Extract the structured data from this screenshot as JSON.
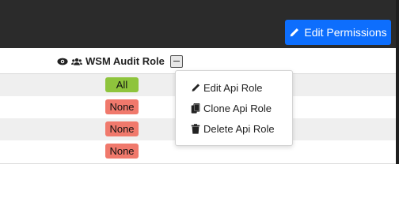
{
  "toolbar": {
    "edit_permissions_label": "Edit Permissions"
  },
  "table": {
    "column_header": "WSM Audit Role",
    "rows": [
      {
        "value": "All",
        "status": "all"
      },
      {
        "value": "None",
        "status": "none"
      },
      {
        "value": "None",
        "status": "none"
      },
      {
        "value": "None",
        "status": "none"
      }
    ]
  },
  "dropdown": {
    "items": [
      {
        "label": "Edit Api Role",
        "icon": "pencil-icon"
      },
      {
        "label": "Clone Api Role",
        "icon": "copy-icon"
      },
      {
        "label": "Delete Api Role",
        "icon": "trash-icon"
      }
    ]
  },
  "colors": {
    "primary": "#0d6efd",
    "badge_all": "#8ec43c",
    "badge_none": "#f0796c"
  }
}
